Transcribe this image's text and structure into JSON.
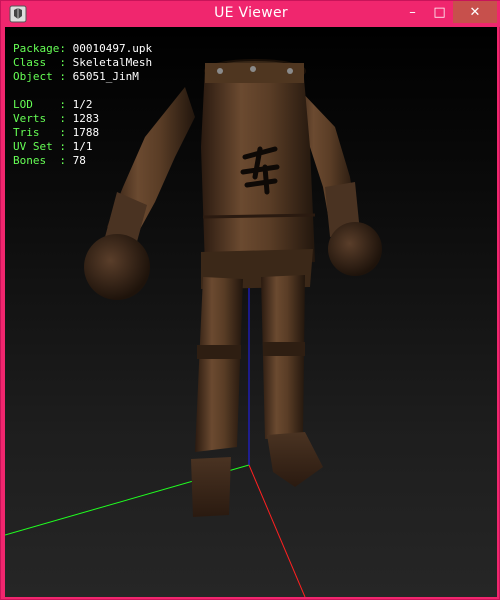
{
  "window": {
    "title": "UE Viewer",
    "controls": {
      "minimize": "–",
      "maximize": "□",
      "close": "✕"
    }
  },
  "info": {
    "package_label": "Package",
    "package_value": "00010497.upk",
    "class_label": "Class  ",
    "class_value": "SkeletalMesh",
    "object_label": "Object ",
    "object_value": "65051_JinM",
    "lod_label": "LOD    ",
    "lod_value": "1/2",
    "verts_label": "Verts  ",
    "verts_value": "1283",
    "tris_label": "Tris   ",
    "tris_value": "1788",
    "uvset_label": "UV Set ",
    "uvset_value": "1/1",
    "bones_label": "Bones  ",
    "bones_value": "78"
  },
  "colors": {
    "titlebar": "#f0266e",
    "close_button": "#c7504c",
    "info_label": "#66ff55",
    "axis_x": "#ff2020",
    "axis_y": "#20ff20",
    "axis_z": "#2020ff"
  }
}
